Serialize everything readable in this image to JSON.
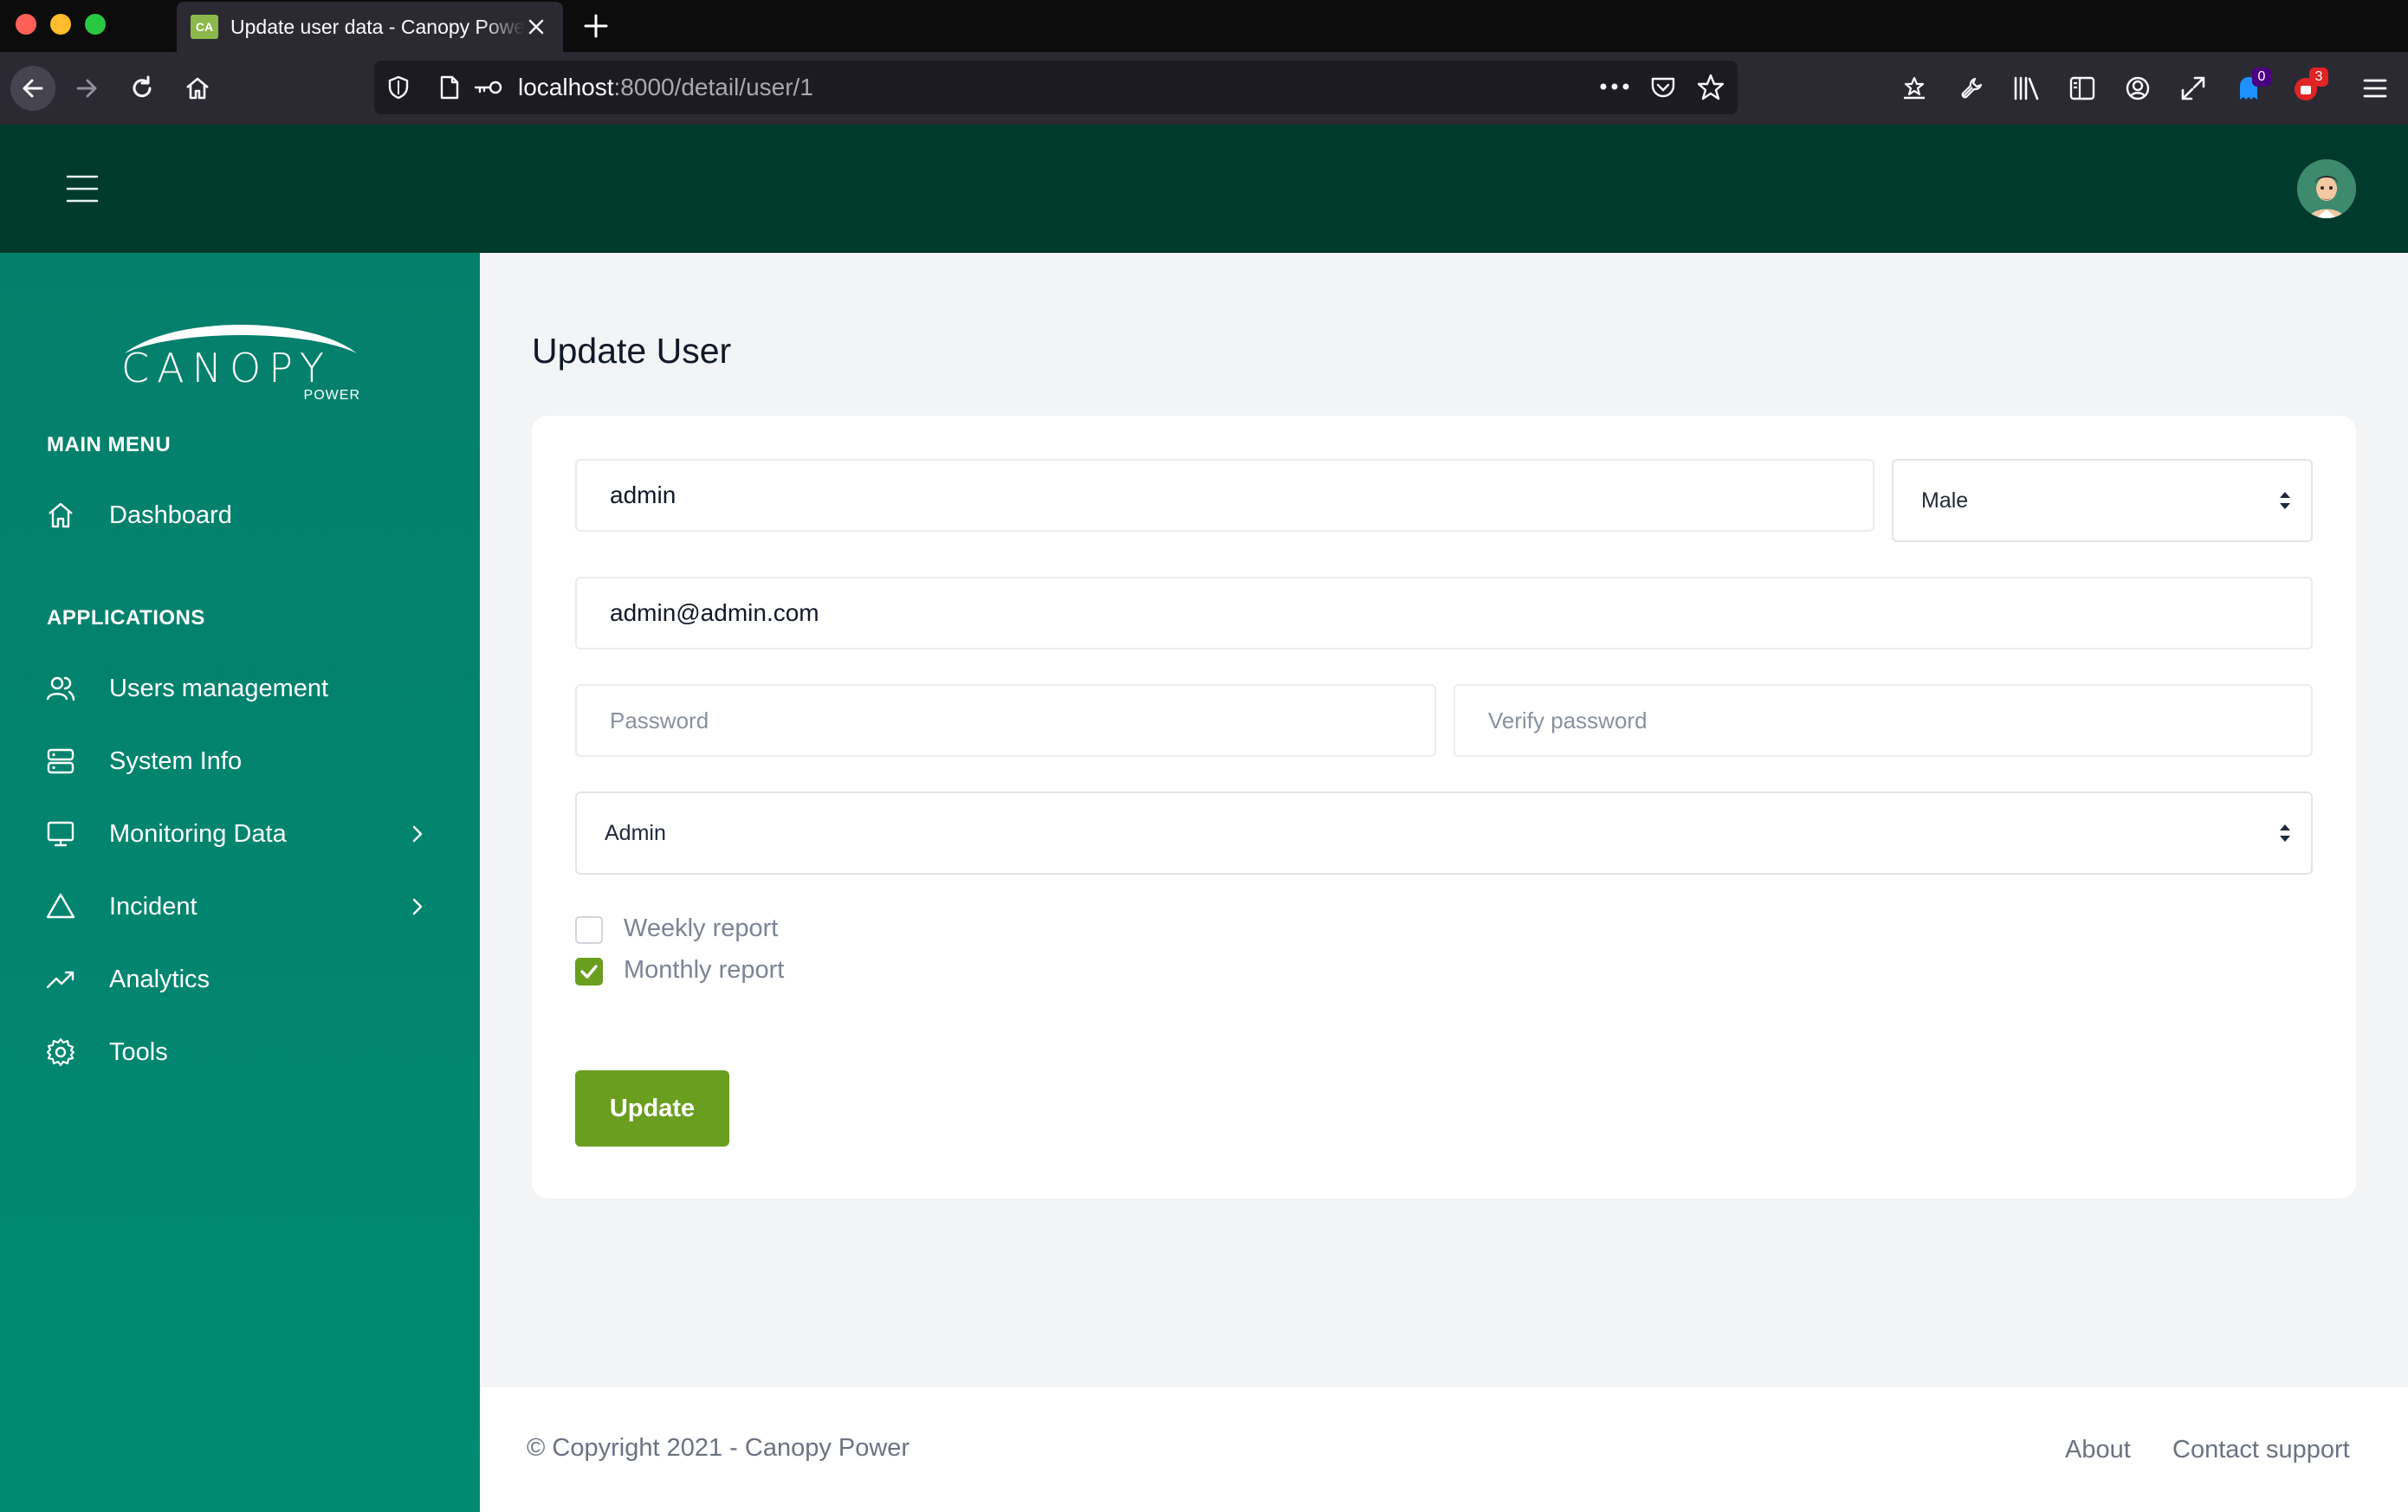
{
  "browser": {
    "tab_title": "Update user data - Canopy Power",
    "favicon_text": "CA",
    "url_host": "localhost",
    "url_path": ":8000/detail/user/1",
    "badge_blue": "0",
    "badge_red": "3"
  },
  "brand": {
    "logo_text": "CANOPY",
    "logo_sub": "POWER",
    "colors": {
      "header": "#003a2b",
      "sidebar": "#047f6b",
      "accent": "#6a9e1f"
    }
  },
  "sidebar": {
    "main_menu_heading": "MAIN MENU",
    "applications_heading": "APPLICATIONS",
    "items": [
      {
        "label": "Dashboard",
        "icon": "home-icon"
      },
      {
        "label": "Users management",
        "icon": "users-icon"
      },
      {
        "label": "System Info",
        "icon": "server-icon"
      },
      {
        "label": "Monitoring Data",
        "icon": "monitor-icon",
        "has_submenu": true
      },
      {
        "label": "Incident",
        "icon": "warning-icon",
        "has_submenu": true
      },
      {
        "label": "Analytics",
        "icon": "trending-up-icon"
      },
      {
        "label": "Tools",
        "icon": "gear-icon"
      }
    ]
  },
  "main": {
    "page_title": "Update User",
    "form": {
      "username_value": "admin",
      "gender_selected": "Male",
      "email_value": "admin@admin.com",
      "password_placeholder": "Password",
      "verify_password_placeholder": "Verify password",
      "role_selected": "Admin",
      "weekly_report_label": "Weekly report",
      "weekly_report_checked": false,
      "monthly_report_label": "Monthly report",
      "monthly_report_checked": true,
      "submit_label": "Update"
    }
  },
  "footer": {
    "copyright": "© Copyright 2021 - Canopy Power",
    "about_label": "About",
    "contact_label": "Contact support"
  }
}
